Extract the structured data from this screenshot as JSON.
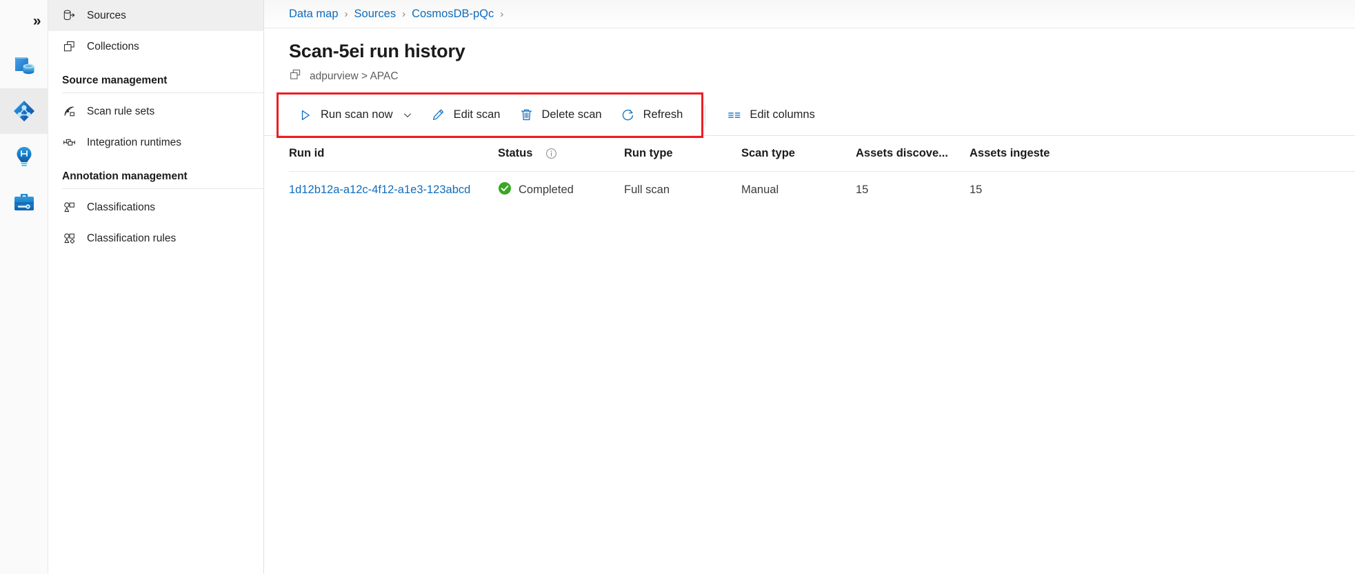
{
  "rail": {
    "toggle_label": "»",
    "items": [
      {
        "name": "data-catalog",
        "title": "Data catalog",
        "active": false
      },
      {
        "name": "data-map",
        "title": "Data map",
        "active": true
      },
      {
        "name": "insights",
        "title": "Insights",
        "active": false
      },
      {
        "name": "management",
        "title": "Management",
        "active": false
      }
    ]
  },
  "sidebar": {
    "items": [
      {
        "label": "Sources",
        "icon": "sources-icon",
        "active": true
      },
      {
        "label": "Collections",
        "icon": "collections-icon",
        "active": false
      }
    ],
    "groups": [
      {
        "title": "Source management",
        "items": [
          {
            "label": "Scan rule sets",
            "icon": "scan-rule-sets-icon"
          },
          {
            "label": "Integration runtimes",
            "icon": "integration-runtimes-icon"
          }
        ]
      },
      {
        "title": "Annotation management",
        "items": [
          {
            "label": "Classifications",
            "icon": "classifications-icon"
          },
          {
            "label": "Classification rules",
            "icon": "classification-rules-icon"
          }
        ]
      }
    ]
  },
  "breadcrumb": {
    "separator": "›",
    "items": [
      "Data map",
      "Sources",
      "CosmosDB-pQc"
    ],
    "trailing_separator": "›"
  },
  "page": {
    "title": "Scan-5ei run history",
    "collection_icon": "collection-icon",
    "subtitle": "adpurview > APAC"
  },
  "toolbar": {
    "run_scan_now": "Run scan now",
    "run_scan_now_caret": "chevron-down-icon",
    "edit_scan": "Edit scan",
    "delete_scan": "Delete scan",
    "refresh": "Refresh",
    "edit_columns": "Edit columns",
    "highlight_color": "#ed1c24"
  },
  "table": {
    "columns": [
      {
        "key": "run_id",
        "label": "Run id"
      },
      {
        "key": "status",
        "label": "Status",
        "info_icon": "info-icon"
      },
      {
        "key": "run_type",
        "label": "Run type"
      },
      {
        "key": "scan_type",
        "label": "Scan type"
      },
      {
        "key": "assets_discovered",
        "label": "Assets discove..."
      },
      {
        "key": "assets_ingested",
        "label": "Assets ingeste"
      }
    ],
    "rows": [
      {
        "run_id": "1d12b12a-a12c-4f12-a1e3-123abcd",
        "status": "Completed",
        "status_icon": "success-check-icon",
        "status_color": "#3aa724",
        "run_type": "Full scan",
        "scan_type": "Manual",
        "assets_discovered": "15",
        "assets_ingested": "15"
      }
    ]
  },
  "colors": {
    "link": "#0f6cbd",
    "accent": "#0f6cbd",
    "success": "#3aa724",
    "highlight": "#ed1c24"
  }
}
